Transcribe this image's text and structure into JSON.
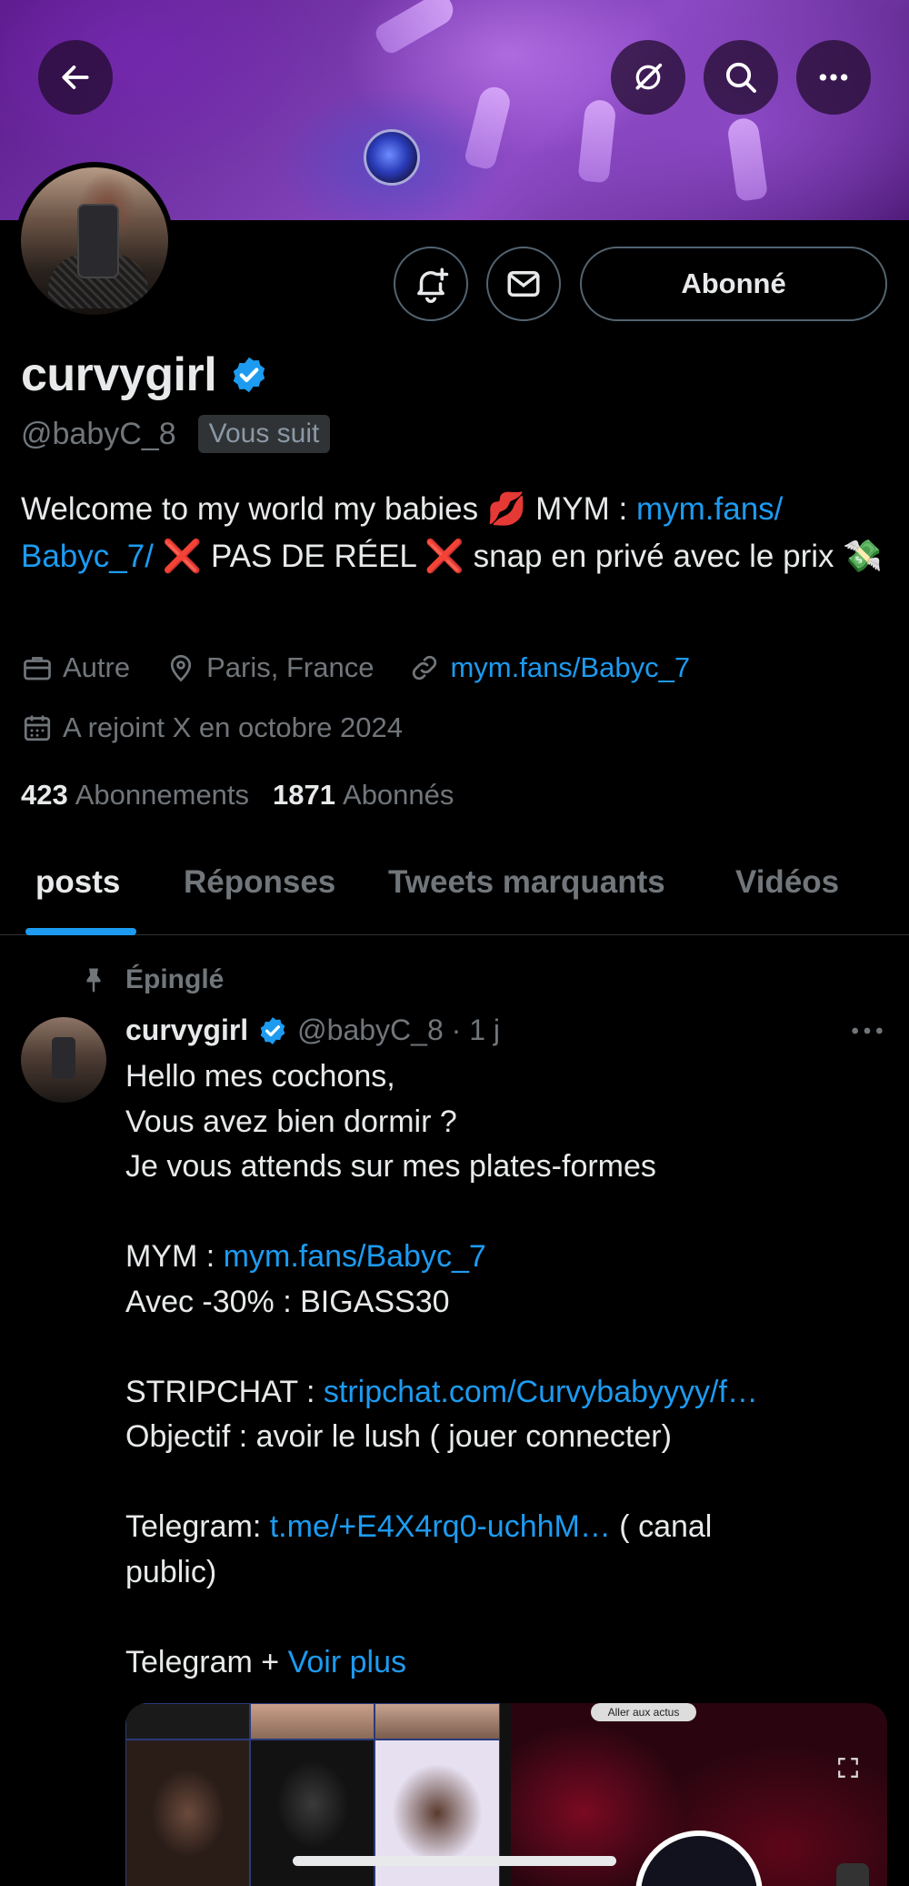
{
  "profile": {
    "name": "curvygirl",
    "handle": "@babyC_8",
    "follows_you": "Vous suit",
    "follow_button": "Abonné",
    "bio_part1": "Welcome to my world my babies 💋 MYM : ",
    "bio_link": "mym.fans/ Babyc_7/",
    "bio_part2": " ❌ PAS DE RÉEL ❌ snap en privé avec le prix 💸",
    "category": "Autre",
    "location": "Paris, France",
    "website": "mym.fans/Babyc_7",
    "joined": "A rejoint X en octobre 2024",
    "following_count": "423",
    "following_label": "Abonnements",
    "followers_count": "1871",
    "followers_label": "Abonnés"
  },
  "tabs": [
    "posts",
    "Réponses",
    "Tweets marquants",
    "Vidéos"
  ],
  "post": {
    "pinned_label": "Épinglé",
    "author": "curvygirl",
    "meta": "@babyC_8 · 1 j",
    "line1": "Hello mes cochons,",
    "line2": "Vous avez bien dormir ?",
    "line3": "Je vous attends sur mes plates-formes",
    "mym_label": "MYM : ",
    "mym_link": "mym.fans/Babyc_7",
    "promo": "Avec -30% : BIGASS30",
    "strip_label": "STRIPCHAT : ",
    "strip_link": "stripchat.com/Curvybabyyyy/f…",
    "objective": "Objectif : avoir le lush ( jouer connecter)",
    "tg_label": "Telegram: ",
    "tg_link": "t.me/+E4X4rq0-uchhM…",
    "tg_after": " ( canal",
    "tg_after2": "public)",
    "tg2": "Telegram + ",
    "see_more": "Voir plus",
    "media_pill": "Aller aux actus"
  },
  "colors": {
    "accent": "#1d9bf0",
    "muted": "#71767b",
    "text": "#e7e9ea",
    "verified": "#1d9bf0"
  }
}
